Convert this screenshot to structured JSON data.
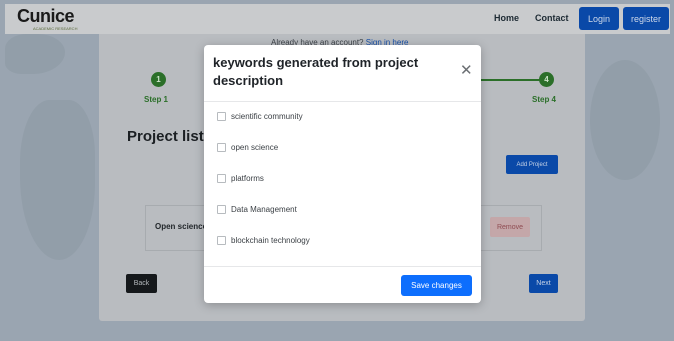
{
  "navbar": {
    "logo": "Cunice",
    "logo_sub": "ACADEMIC RESEARCH",
    "home": "Home",
    "contact": "Contact",
    "login": "Login",
    "register": "register"
  },
  "page": {
    "already_account": "Already have an account?",
    "sign_in": "Sign in here",
    "steps": [
      {
        "number": "1",
        "label": "Step 1"
      },
      {
        "number": "4",
        "label": "Step 4"
      }
    ],
    "project_list_title": "Project list",
    "add_project": "Add Project",
    "project_name": "Open science",
    "remove": "Remove",
    "back": "Back",
    "next": "Next"
  },
  "modal": {
    "title": "keywords generated from project description",
    "close_symbol": "✕",
    "keywords": [
      "scientific community",
      "open science",
      "platforms",
      "Data Management",
      "blockchain technology"
    ],
    "save": "Save changes"
  },
  "colors": {
    "primary": "#0d6efd",
    "step_green": "#2b6f29"
  }
}
